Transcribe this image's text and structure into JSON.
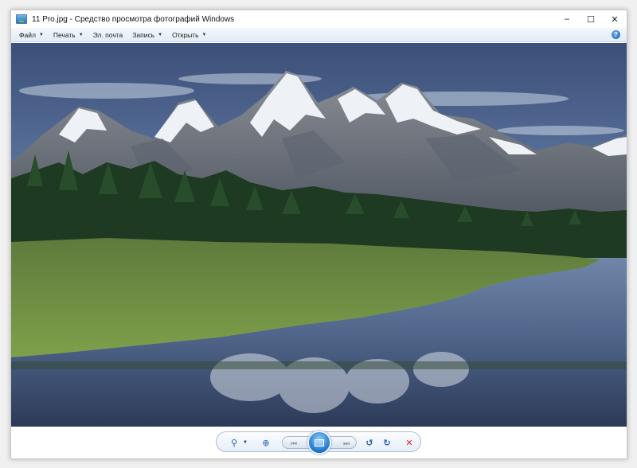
{
  "window": {
    "title": "11 Pro.jpg - Средство просмотра фотографий Windows",
    "controls": {
      "minimize": "–",
      "maximize": "☐",
      "close": "✕"
    }
  },
  "menu": {
    "items": [
      {
        "label": "Файл",
        "has_dropdown": true
      },
      {
        "label": "Печать",
        "has_dropdown": true
      },
      {
        "label": "Эл. почта",
        "has_dropdown": false
      },
      {
        "label": "Запись",
        "has_dropdown": true
      },
      {
        "label": "Открыть",
        "has_dropdown": true
      }
    ],
    "help": "?"
  },
  "photo": {
    "description_icon": "mountain-landscape-photo"
  },
  "toolbar": {
    "icons": [
      "zoom-icon",
      "actual-size-icon",
      "previous-icon",
      "slideshow-icon",
      "next-icon",
      "rotate-left-icon",
      "rotate-right-icon",
      "delete-icon"
    ]
  },
  "colors": {
    "accent": "#1b73c9",
    "delete": "#d9262b"
  }
}
